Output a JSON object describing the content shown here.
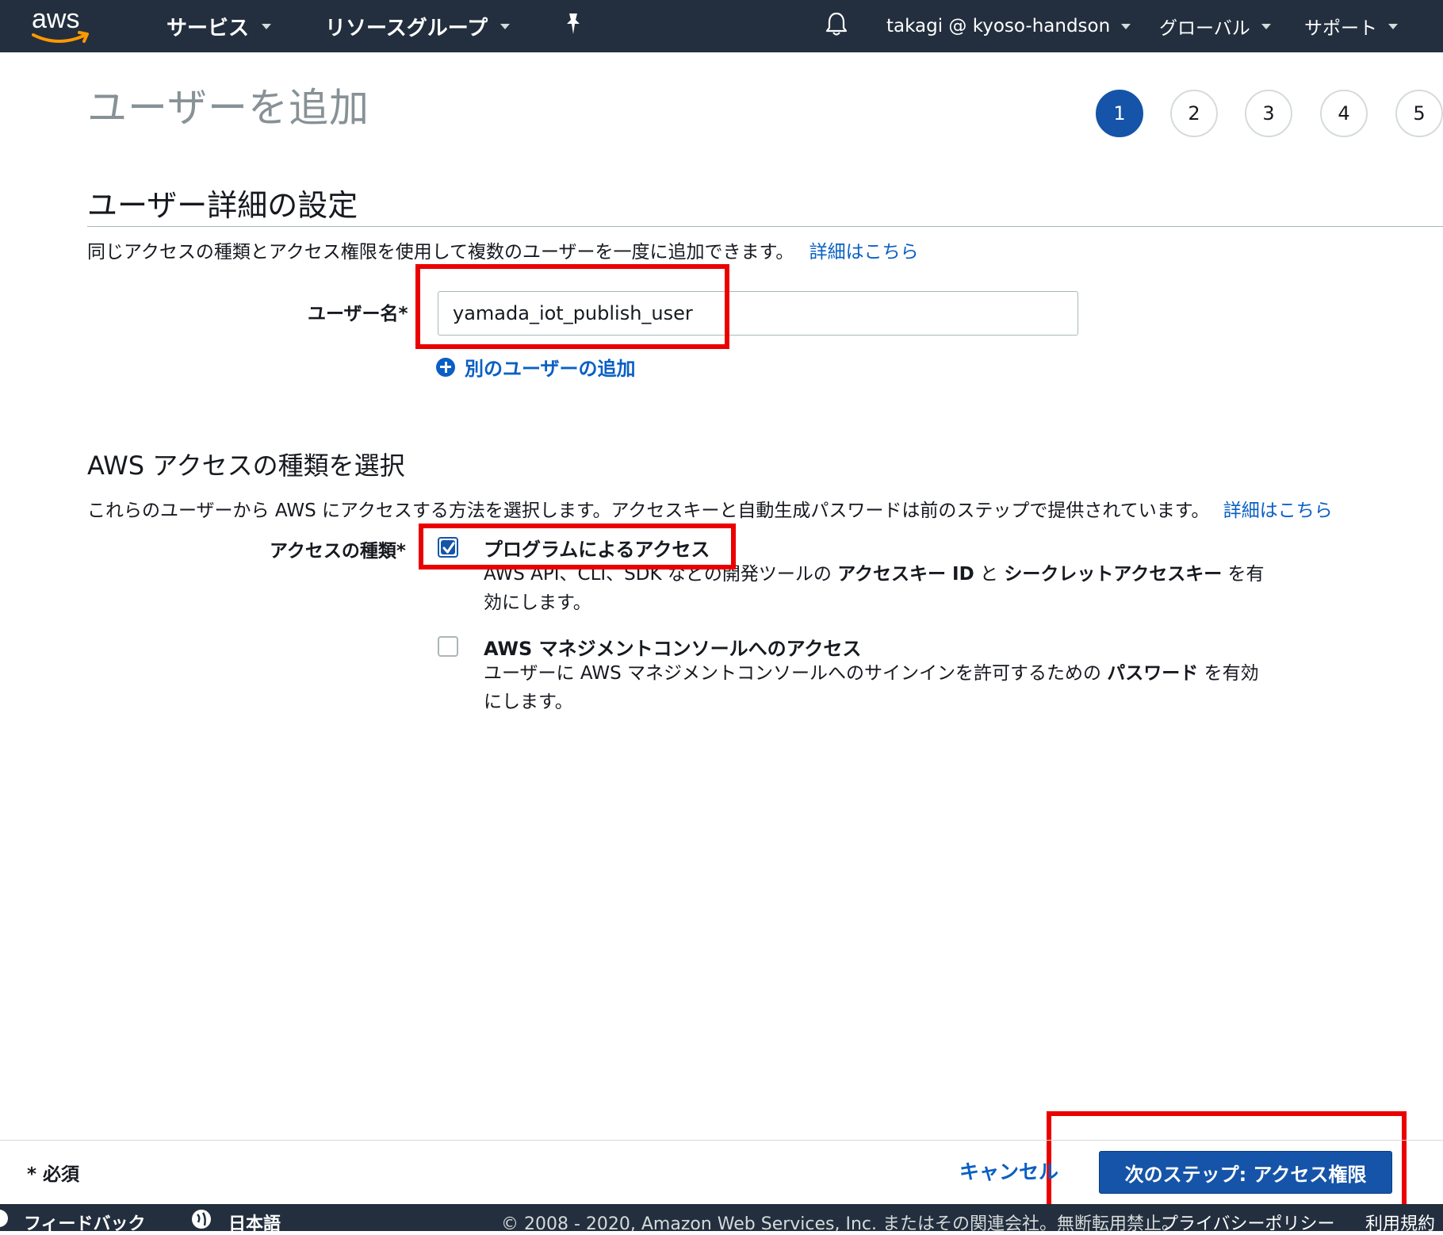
{
  "topnav": {
    "logo_text": "aws",
    "services": "サービス",
    "resource_groups": "リソースグループ",
    "account": "takagi @ kyoso-handson",
    "region": "グローバル",
    "support": "サポート"
  },
  "header": {
    "title": "ユーザーを追加",
    "steps": [
      "1",
      "2",
      "3",
      "4",
      "5"
    ],
    "active_step": "1"
  },
  "user_details": {
    "heading": "ユーザー詳細の設定",
    "description": "同じアクセスの種類とアクセス権限を使用して複数のユーザーを一度に追加できます。",
    "learn_more": "詳細はこちら",
    "username_label": "ユーザー名*",
    "username_value": "yamada_iot_publish_user",
    "add_another_user": "別のユーザーの追加"
  },
  "access_type": {
    "heading": "AWS アクセスの種類を選択",
    "description": "これらのユーザーから AWS にアクセスする方法を選択します。アクセスキーと自動生成パスワードは前のステップで提供されています。",
    "learn_more": "詳細はこちら",
    "label": "アクセスの種類*",
    "programmatic": {
      "title": "プログラムによるアクセス",
      "checked": true,
      "desc_prefix": "AWS API、CLI、SDK などの開発ツールの",
      "desc_bold1": "アクセスキー ID",
      "desc_mid": "と",
      "desc_bold2": "シークレットアクセスキー",
      "desc_suffix": "を有効にします。"
    },
    "console": {
      "title": "AWS マネジメントコンソールへのアクセス",
      "checked": false,
      "desc_prefix": "ユーザーに AWS マネジメントコンソールへのサインインを許可するための",
      "desc_bold": "パスワード",
      "desc_suffix": "を有効にします。"
    }
  },
  "footer": {
    "required_note": "* 必須",
    "cancel": "キャンセル",
    "next_button": "次のステップ: アクセス権限"
  },
  "bottom_bar": {
    "feedback": "フィードバック",
    "language": "日本語",
    "copyright": "© 2008 - 2020, Amazon Web Services, Inc. またはその関連会社。無断転用禁止。",
    "privacy": "プライバシーポリシー",
    "terms": "利用規約"
  },
  "colors": {
    "nav_bg": "#232f3e",
    "primary_blue": "#1554a8",
    "link_blue": "#0a5fc4",
    "highlight_red": "#ea0000"
  }
}
